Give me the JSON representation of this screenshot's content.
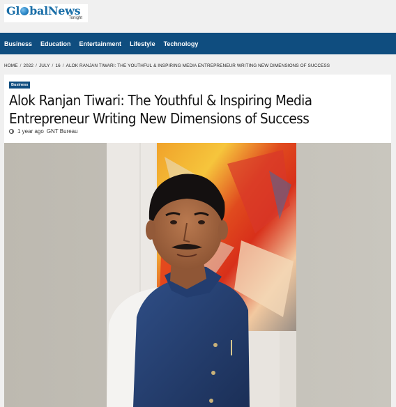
{
  "site": {
    "logo_prefix": "Gl",
    "logo_suffix": "balNews",
    "logo_sub": "Tonight"
  },
  "nav": {
    "items": [
      "Business",
      "Education",
      "Entertainment",
      "Lifestyle",
      "Technology"
    ]
  },
  "breadcrumb": {
    "items": [
      "HOME",
      "2022",
      "JULY",
      "16",
      "ALOK RANJAN TIWARI: THE YOUTHFUL & INSPIRING MEDIA ENTREPRENEUR WRITING NEW DIMENSIONS OF SUCCESS"
    ],
    "separator": "/"
  },
  "article": {
    "category": "Business",
    "title_line1": "Alok Ranjan Tiwari: The Youthful & Inspiring Media",
    "title_line2": "Entrepreneur Writing New Dimensions of Success",
    "time_ago": "1 year ago",
    "author": "GNT Bureau",
    "image_icon": "portrait-photo"
  },
  "colors": {
    "brand_blue": "#0f4d7f",
    "logo_blue": "#1b6fa8",
    "background": "#f0f0f0"
  }
}
